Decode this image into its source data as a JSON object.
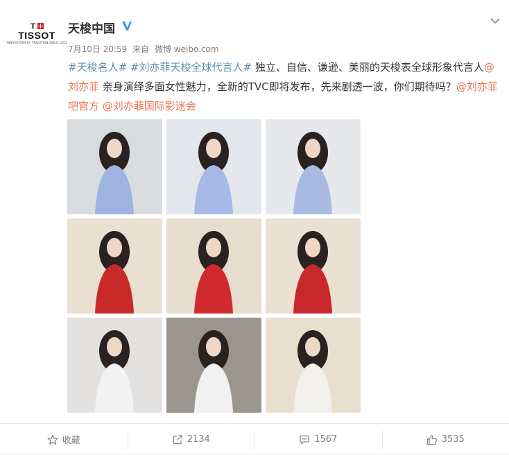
{
  "post": {
    "author": "天梭中国",
    "brand_logo": {
      "mark": "T",
      "name": "TISSOT",
      "tagline": "INNOVATORS BY TRADITION SINCE 1853"
    },
    "verified_icon": "verified-badge-icon",
    "timestamp": "7月10日 20:59",
    "source_prefix": "来自",
    "source": "微博 weibo.com",
    "text": {
      "hashtag1": "#天梭名人#",
      "hashtag2": "#刘亦菲天梭全球代言人#",
      "body1": " 独立、自信、谦逊、美丽的天梭表全球形象代言人",
      "mention1": "@刘亦菲",
      "body2": " 亲身演绎多面女性魅力，全新的TVC即将发布，先来剧透一波，你们期待吗？",
      "mention2": "@刘亦菲吧官方",
      "mention3": "@刘亦菲国际影迷会"
    },
    "images": [
      {
        "name": "photo-1-blue-gown-standing",
        "bg": "#d9dcdf",
        "fig": "#9fb3e0"
      },
      {
        "name": "photo-2-blue-gown-reclining",
        "bg": "#e3e6ea",
        "fig": "#a7b9e6"
      },
      {
        "name": "photo-3-blue-gown-closeup",
        "bg": "#e6e8ec",
        "fig": "#a9bbe4"
      },
      {
        "name": "photo-4-red-jacket-standing",
        "bg": "#e9e0d2",
        "fig": "#c82a2a"
      },
      {
        "name": "photo-5-red-jacket-studio",
        "bg": "#e6ddcf",
        "fig": "#d02a2e"
      },
      {
        "name": "photo-6-red-jacket-shoulder",
        "bg": "#ebe1d3",
        "fig": "#c8282c"
      },
      {
        "name": "photo-7-white-shirt-wall",
        "bg": "#e4e2e0",
        "fig": "#f3f3f3"
      },
      {
        "name": "photo-8-white-shirt-table",
        "bg": "#9a958e",
        "fig": "#f1f1f1"
      },
      {
        "name": "photo-9-white-shirt-hands",
        "bg": "#e9dfce",
        "fig": "#f2f0ec"
      }
    ],
    "actions": {
      "favorite_label": "收藏",
      "repost_count": "2134",
      "comment_count": "1567",
      "like_count": "3535"
    },
    "colors": {
      "link": "#eb7350",
      "topic": "#5a8fb3",
      "verified": "#3d9ae8",
      "meta": "#808080"
    }
  }
}
